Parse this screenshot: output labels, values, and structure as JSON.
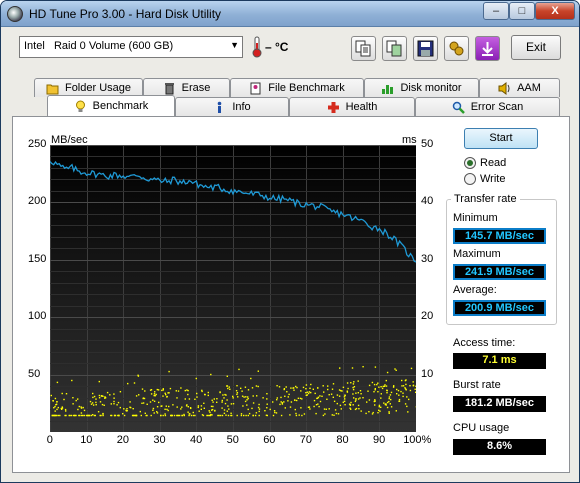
{
  "window": {
    "title": "HD Tune Pro 3.00 - Hard Disk Utility",
    "controls": {
      "minimize": "–",
      "maximize": "□",
      "close": "X"
    }
  },
  "toolbar": {
    "drive": "Intel   Raid 0 Volume (600 GB)",
    "temperature": "– °C",
    "exit_label": "Exit",
    "icons": [
      "copy-text-icon",
      "copy-screenshot-icon",
      "save-icon",
      "options-icon",
      "download-icon"
    ]
  },
  "tabs": {
    "top": [
      {
        "label": "Folder Usage",
        "icon": "folder-icon"
      },
      {
        "label": "Erase",
        "icon": "trash-icon"
      },
      {
        "label": "File Benchmark",
        "icon": "file-benchmark-icon"
      },
      {
        "label": "Disk monitor",
        "icon": "disk-monitor-icon"
      },
      {
        "label": "AAM",
        "icon": "speaker-icon"
      }
    ],
    "bottom": [
      {
        "label": "Benchmark",
        "icon": "lightbulb-icon",
        "active": true
      },
      {
        "label": "Info",
        "icon": "info-icon"
      },
      {
        "label": "Health",
        "icon": "health-cross-icon"
      },
      {
        "label": "Error Scan",
        "icon": "magnifier-icon"
      }
    ]
  },
  "benchmark": {
    "start_label": "Start",
    "mode_options": [
      {
        "label": "Read",
        "selected": true
      },
      {
        "label": "Write",
        "selected": false
      }
    ],
    "transfer_rate": {
      "title": "Transfer rate",
      "minimum_label": "Minimum",
      "minimum": "145.7 MB/sec",
      "maximum_label": "Maximum",
      "maximum": "241.9 MB/sec",
      "average_label": "Average:",
      "average": "200.9 MB/sec"
    },
    "access_time_label": "Access time:",
    "access_time": "7.1 ms",
    "burst_rate_label": "Burst rate",
    "burst_rate": "181.2 MB/sec",
    "cpu_usage_label": "CPU usage",
    "cpu_usage": "8.6%"
  },
  "chart_data": {
    "type": "line",
    "ylabel_left": "MB/sec",
    "ylabel_right": "ms",
    "ylim_left": [
      0,
      250
    ],
    "ylim_right": [
      0,
      50
    ],
    "yticks_left": [
      "250",
      "200",
      "150",
      "100",
      "50"
    ],
    "yticks_right": [
      "50",
      "40",
      "30",
      "20",
      "10"
    ],
    "xlim": [
      0,
      100
    ],
    "xticks": [
      "0",
      "10",
      "20",
      "30",
      "40",
      "50",
      "60",
      "70",
      "80",
      "90",
      "100%"
    ],
    "grid": true,
    "series": [
      {
        "type": "line",
        "color": "#1f9ad6",
        "x": [
          0,
          2,
          4,
          6,
          8,
          10,
          12,
          14,
          16,
          18,
          20,
          22,
          24,
          26,
          28,
          30,
          32,
          34,
          36,
          38,
          40,
          42,
          44,
          46,
          48,
          50,
          52,
          54,
          56,
          58,
          60,
          62,
          64,
          66,
          68,
          70,
          72,
          74,
          76,
          78,
          80,
          82,
          84,
          86,
          88,
          90,
          92,
          94,
          96,
          98,
          100
        ],
        "y": [
          237,
          233,
          229,
          230,
          227,
          226,
          225,
          224,
          223,
          224,
          223,
          222,
          224,
          221,
          220,
          219,
          218,
          220,
          217,
          219,
          216,
          214,
          213,
          213,
          211,
          210,
          209,
          208,
          207,
          206,
          204,
          203,
          203,
          201,
          199,
          198,
          197,
          196,
          193,
          191,
          190,
          187,
          185,
          183,
          179,
          177,
          173,
          168,
          162,
          155,
          148
        ]
      },
      {
        "type": "scatter",
        "color": "#ffff00",
        "y_axis": "right",
        "x_range": [
          0,
          100
        ],
        "y_range": [
          3,
          11.5
        ]
      }
    ]
  }
}
